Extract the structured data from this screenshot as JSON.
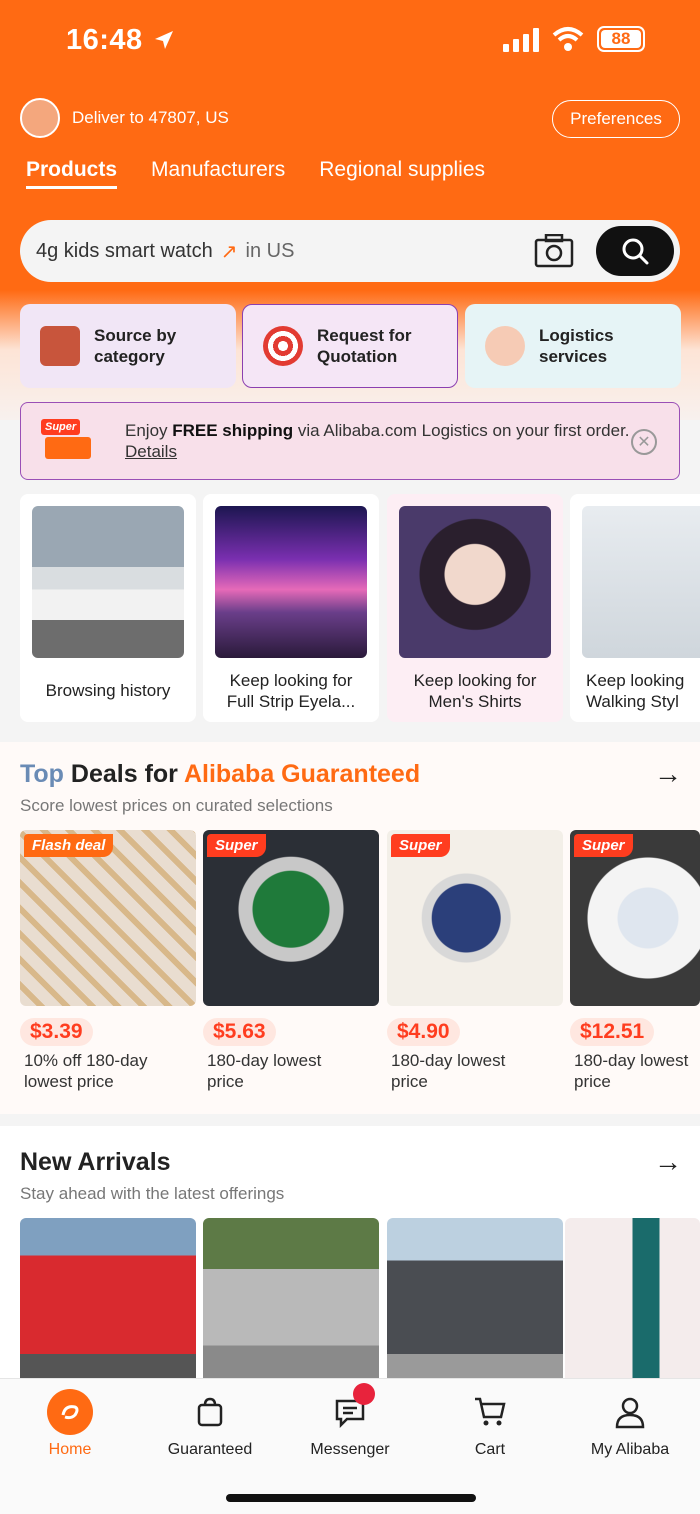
{
  "status": {
    "time": "16:48",
    "battery": "88"
  },
  "header": {
    "deliver_to": "Deliver to 47807, US",
    "preferences": "Preferences",
    "tabs": [
      "Products",
      "Manufacturers",
      "Regional supplies"
    ]
  },
  "search": {
    "query": "4g kids smart watch",
    "trend_icon": "↗",
    "scope": "in US"
  },
  "quick_actions": [
    {
      "label_1": "Source by",
      "label_2": "category",
      "icon": "box-icon",
      "color": "#c8553c"
    },
    {
      "label_1": "Request for",
      "label_2": "Quotation",
      "icon": "target-icon",
      "color": "#e23b32"
    },
    {
      "label_1": "Logistics",
      "label_2": "services",
      "icon": "plane-icon",
      "color": "#ef7d4a"
    }
  ],
  "banner": {
    "tag": "Super",
    "text_before": "Enjoy ",
    "text_bold": "FREE shipping",
    "text_after": " via Alibaba.com Logistics on your first order. ",
    "link": "Details"
  },
  "recent": [
    {
      "caption_1": "Browsing history",
      "caption_2": ""
    },
    {
      "caption_1": "Keep looking for",
      "caption_2": "Full Strip Eyela..."
    },
    {
      "caption_1": "Keep looking for",
      "caption_2": "Men's Shirts"
    },
    {
      "caption_1": "Keep looking",
      "caption_2": "Walking Styl"
    }
  ],
  "deals": {
    "title_1": "Top",
    "title_2": "Deals for ",
    "title_3": "Alibaba Guaranteed",
    "subtitle": "Score lowest prices on curated selections",
    "items": [
      {
        "badge": "Flash deal",
        "price": "$3.39",
        "label_1": "10% off 180-day",
        "label_2": "lowest price"
      },
      {
        "badge": "Super",
        "price": "$5.63",
        "label_1": "180-day lowest",
        "label_2": "price"
      },
      {
        "badge": "Super",
        "price": "$4.90",
        "label_1": "180-day lowest",
        "label_2": "price"
      },
      {
        "badge": "Super",
        "price": "$12.51",
        "label_1": "180-day lowest",
        "label_2": "price"
      }
    ]
  },
  "arrivals": {
    "title": "New Arrivals",
    "subtitle": "Stay ahead with the latest offerings"
  },
  "tabbar": [
    {
      "label": "Home",
      "icon": "home-icon"
    },
    {
      "label": "Guaranteed",
      "icon": "shield-bag-icon"
    },
    {
      "label": "Messenger",
      "icon": "chat-icon"
    },
    {
      "label": "Cart",
      "icon": "cart-icon"
    },
    {
      "label": "My Alibaba",
      "icon": "person-icon"
    }
  ],
  "colors": {
    "brand": "#ff6a13",
    "price": "#ff3d1f"
  }
}
